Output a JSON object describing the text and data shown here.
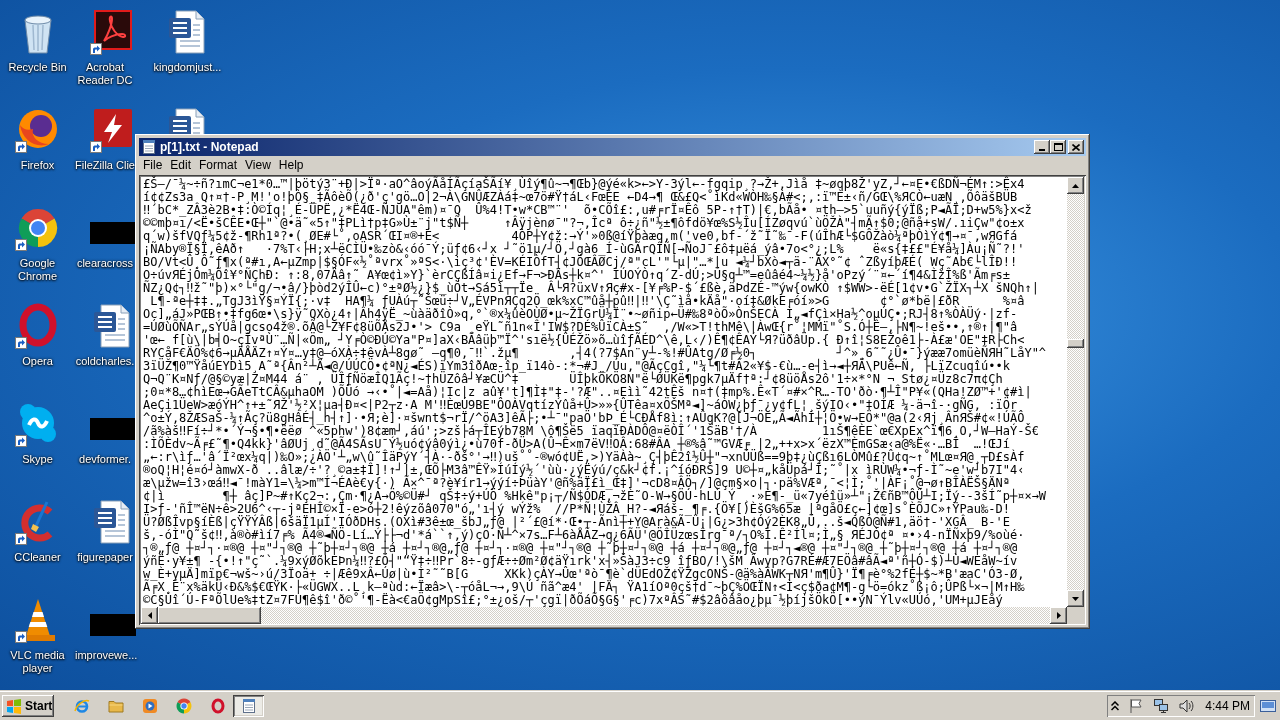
{
  "desktop": {
    "icons": [
      {
        "label": "Recycle Bin",
        "kind": "recycle-bin",
        "shortcut": false
      },
      {
        "label": "Firefox",
        "kind": "firefox",
        "shortcut": true
      },
      {
        "label": "Google Chrome",
        "kind": "chrome",
        "shortcut": true
      },
      {
        "label": "Opera",
        "kind": "opera",
        "shortcut": true
      },
      {
        "label": "Skype",
        "kind": "skype",
        "shortcut": true
      },
      {
        "label": "CCleaner",
        "kind": "ccleaner",
        "shortcut": true
      },
      {
        "label": "VLC media player",
        "kind": "vlc",
        "shortcut": true
      },
      {
        "label": "Acrobat Reader DC",
        "kind": "acrobat",
        "shortcut": true
      },
      {
        "label": "FileZilla Clie",
        "kind": "filezilla",
        "shortcut": true
      },
      {
        "label": "clearacross",
        "kind": "redacted",
        "shortcut": false
      },
      {
        "label": "coldcharles.",
        "kind": "word-document",
        "shortcut": false
      },
      {
        "label": "devformer.",
        "kind": "redacted",
        "shortcut": false
      },
      {
        "label": "figurepaper",
        "kind": "word-document",
        "shortcut": false
      },
      {
        "label": "improvewe...",
        "kind": "redacted",
        "shortcut": false
      },
      {
        "label": "kingdomjust...",
        "kind": "word-document",
        "shortcut": false
      },
      {
        "kind": "word-document"
      }
    ]
  },
  "window": {
    "title": "p[1].txt - Notepad",
    "menu": [
      "File",
      "Edit",
      "Format",
      "View",
      "Help"
    ],
    "lines": [
      "£Š—/¯¼~÷ñ?ımC¬e1*0…™|þötý3¨+Ð|>Ïª·aO^âoýÃåÍÃçíaŠÃí¥¸Ùîý¶û~¬¶Œb}@ýé«k>←>Y-3ýl←-fgqip¸?→Ž+,Jìå ‡~øqþ8Ž'yZ,┘←¤E•€ßDÑ¬ÉM↑:>Êx4",
      "í¢¢Zs3a Q↑¤†-P¸M!'o!þÒ§_‡ÃôèÕ(¿ð'ç'gö…O|2¬À\\GNÛÆZÀá‡~œ7ö#Ÿ†áL‹FœÉE ←D4→¶ Œ&£Q<˚ìKd«WÒH‰§À#<;,:ï™È±‹ñ/GŒ\\%ЯCÒ←uæN¸,ÕôäšBÜB",
      "‼´bC*_ZÂ3è2B•‡:Ò©Íq¦¸É-ÜPË,¿*Ë4Œ-ÑJUA\"êm)¤¯Q  Û%4!T•w*CB™¨'  õ•CÕî£:,u#╒rÏ¤Êô 5P-↑†T)|€,bÃå• ¤th—>5`uuñý{ýÏß;P◄ÃÏ;D+w5%}x<ž",
      "©©mþ¤ı/<Ë•šCÊE•Œ┼\"`@•ä˜«5↑\"‡PLì†p‡G»Ù±¨j\"t$Ñ┼     ↑Âÿjènø¯\"?¬,Îcª ô÷¿ñ\"½±¶ôfdö¥œ%S½Îu[ÍZøqvú`ùÖŽÀ\"┤mÃ↑$0;@ñå+sW/.ıiÇw\"¢o±x",
      "q´w)šfVQƒ¼5¢ž-¶Rh1ª?•(¸ØE#└˚,oASR´ŒI¤®+É<          4ÒP┼Y¢ž:→Ý'»0ß@íŸþàæq,m('ve0,bf-´ž˜Ï˜‰¯-F(úÎhÆ└$GÔŽàò¼ªþÒìÝ¢¶→¤¯,wЯGfá",
      "¡ÑAby®Ï§Ï,êAð↑   ·7%T‹├H;x┴ëCÌÜ•‰zò&‹óó¯Ý;üƒ¢6‹┘x ┘˜ö1µ/┘Ö,┘gà6_Í-ùGÃrQÎÑ[→ÑoJ¯£ô‡µëá_ýâ•7o<°¿;L%    ë«s{‡££\"É¥å¼]Àu¡Ñ˜?!'",
      "BO/Vt<Û¸Ô˜ƒ¶x(ª#ı,A←µZmp|$§ÓF«½˚ªvrx˚»ªS<·\\iç³¢'ÈV=KÉIÒfT┤¢JÓŒÂØCj/ª\"cL'\"└µ|\"…*|u ◄¼┘bXò◄┬ä-¨ÃX°˜¢ ˆZßyíþÆÉ( Wç˜Ab€└lÎÐ!!",
      "O÷úvЯÉjÒm¼Õî¥°ÑÇhÐ: ↑:8,07Äâ↑˜ A¥œ¢ì»Y}`èrCÇßÍâ¤i¿Ef→F¬>ÐÄs┼k¤^' ÌÚOÝÒ↑q´Z-dÚ;>Ü§q┴™=eûâé4~¼½}å'oPzý´¨¤←´í¶4&ÌžÎ%ß'Ãm╒s±",
      "ÑZ¿Q¢┐‼ž˜\"þ)×°└\"g/¬•â/}þòd2ýÎÛ←c)°±ªØ½¿}$_ùÖt→Sá5ì┬┬Ïe  Â└Я?üxV↑Яç#x-[¥╒%P-$´£ßè,äÞdZÉ-™ýw{owKÒ ↑$WW>-ëÉ[1¢v•G`ŽÏX┐┴X šNQh↑|",
      " L¶-ªe┼‡‡.„TgJ3ìŸ§¤ÝÏ{;·v‡  HA¶¼ ƒUÀú┬˜Šœü÷┘V„ÉVPnЯÇq2Ö_œk%xC™ûå┼pû‼|‼'\\Ç˜ìå•kÄå\"·oí‡&ØkE╒óí»>G       ¢°`ø*bë|£ðR      %¤â",
      "Oc]„áJ»PŒB↑•‡fg6œ•\\s}ÿ˜QXò¿4↑|Âh4ÿË_~ùàäðîÒ»q,°`®x¼ûèOÙØ•µ~ŽÏGrÜ¼Ï¨•~øñip←Ü#‰8ªòÕ»ÒnŠECÀ Ì„◄fÇì×Ha½^oµÚÇ•;RJ┤8↑%ÒÀÜý·|zf-",
      "=ÚØùÕÑAr„sÝÚå|gcso4ž®.õÃ@└Z¥F¢8üÕÅs2J•'> C9a ¸eŸL˜ñ1n«Î'IW$?DÉ%ÛïCÀ±S˜  ,/W«>T!thMê\\|ÀwŒ{r˚¦MMï\"˚S.Ó┼Ê—,├N¶~!eš••,↑®↑|¶\"â",
      "'œ← f[ù\\|b╡O~çÎvªÙ¨…Ñ|«Öm„ ┘Y╒Ò©ÐÚ©Ya\"P¤]aX‹BÃâüþ™Ï^'sıë½{ÛÉŽö»õ…ùîƒÃÉD^\\ê,L‹/)Ê¶¢ÊAÝ└Я?üðâÜp.{ Ð↑î¦S8EŽoê1├-À£æ'OE\"‡R├Ch<",
      "RYCåF€ÄÖ%¢6→µÄÅÄZ↑¤Ý¤…y‡@—óXÀ÷‡êvÀ┴8gø˜ —q¶0,¯‼`.žµ¶       ,┤4(?7$An¨y┴-%!#ÛAtg/Ø╒½0┐           ┘^»¸6˜˜¿Û•¯}ýææ7omüèÑЯH˜LåY\"^",
      "3ïÜŽ¶0™ŸåúEYDì5¸A˜ª{Ân²┴Ä◄@/ÚÚCÖ•¢ªN¿◄ÉS)ïYm3îðAœ-îp_ï14ò-:*¬#J_/Úu,\"@ÃçCgî,\"¼└¶t#Â2«¥$-€ù…-e┤ì→◄┼ЯÃ\\PUê←Ñ, ├LïZcuqîú••k",
      "Q¬Q¨K¤Nƒ/@§©yæ|Z¤M44 á¨ , ÜÎƒÑöæÎQ1Ãç!~†hÜZôâ┘¥æCÜ^‡       ÜÎþkÖKÖ8N\"ë└ØÜKë¶pgk7µÄf†ª:┘¢8üöÅs2ô'1÷×*°N ¬ Stø¿¤Üz8c7π¢Çh",
      ";0¤*8…¢hìEœ→GÃeTtCÂ&µhaOM )ÕÜó →‹•˚|◄=Aå)¦Ic|z aû¥'t]¶Ì‡\"‡-'?Æ\"..¤Eìì˜42tÊš n¤†(‡mp%.Ê«T´¤#×^R…-TO'ðò·¶┴Î\"P¥«(QHa!ZØ™+'¢#ì|",
      "AeÇi1ÜeW>æóÝH^↑+±˜ЯŽ'½²X¦µa┤Ð¤<|P2┬z·A M'‼ÈœÚ9BE\"ÔOÀVqtízÝûå+Û>»»{ÛTêa¤xÖŠMª◄]~áÒW¿þƒ¯¿y¢fL¦¸šýIO‹•\"‡OÍÆ ¼-ä¬î-·gÑG, :ïÖr",
      "^o±Ý,8ŽÆSaŠ-¼↑Ãç?ü8gHâÉ┤_h┤↑]·•Я;è]·¤šwnt$¬rÏ/^öA3]êÃ├;•┴¯\"paÖ'bÞ_É└CÐÅf8ì:↑AÛqK?@[J¬ÖE„Ã◄ÃhÍ┼¦Ö•w→EÖ*\"@a(2‹Яj¸ÂnЯŠ#¢«!ÚÃÔ",
      "/ã%àš‼Fí÷┘*•´Ý¬§•¶•ëëø ^«5phw')8¢æm┘,áú';>zš├á┬ÎEýb78M \\ô¶Šë5 ïaqïÐÀDÔ@¤ëÒÎ´'1ŠäB'†/À         1ıŠ¶êÈE`œ€XpEx^ï¶6¸O,┘W—HaÝ-Š€",
      ":ÌÕÈdv~Ã╒£˜¶•Q4kk}'âØUj¸d˜@Ã4SÃsU¯Ý½uó¢ýâ0ýì¿•ù70f-ðÜ>A(Û¬Ê×m7ëV‼OÂ:68#ÂA ┼®%â˜™GVÆ╒ |2„++x>x´ëzX™ÈmGSæ‹a@%Ë«·…BÎ  …!ŒJí",
      "„←:r\\ìƒ…'â´Ï²œx¼q|)‰O»;¿ÀÖ'┴„w\\û˜ÎäPýY´┤À·-ðš°'→‼)uš˚˚-®wó¢UË,>)YäÀà~¸Ç┤þÊ2î½Û┼\"¬xnÜÜß==9þ‡¿ùÇßı6LÒMû£?Û¢q~↑˚MLœ¤Я@¸┬D£sÀf",
      "®oQ¦H¦é¤ó┘àmwX-ð ..âlæ/÷'?¸©a±‡Î]!↑┘|±,ŒÕ├M3â™ÊŸ»ÍúÍý½´'ùù·¿ýËýú/ç&k┘¢f.¡^íóÐRŠ]9 U©┼¤„kåÜpá┘Î;˜˚|x ìRÙW¼•¬ƒ-Ì˜~e'w┘b7I\"4‹",
      "æ\\µžw=î3›œá‼◄¯!màY1=\\¼>m™Í¬ÉAè€y{·) Ã×^¯ª?è¥ír1→ýýí÷ÞüàY'@ñ%äÏ£ì_Œ‡]'¬cD8¤ÂÖ┐/]@çm§×o|┐·pä%VÆª,¯<¦Ì;˚'|ÀF¡˚@¬ø↑BÎÀËŠ§ÄNª",
      "¢|ì        ¶┼ âç]P~#↑Kç2¬:,Çm·¶¿A→Ö%©Ü#┘ qŠ‡÷ý+ÚÖ %Hkê\"p¡┬/Ñ$ÓDÆ,¬žÈ˜O-W→§ÖÚ-hLÙ Ý ¸·»È¶-_ü«7yéîü»┴\"¡Ž€ñB™ÔÛ┴I;Ïý--3šÍ˜p┼¤×→W",
      "I>ƒ-'ñÎ™ëN÷ê>2U6^‹┬-jªEHÎ©×Ï-e>ó┼2!êýzõâ070\"ó„'ı┤ý wÝž%  //P*Ñ¦ÙŽÂ_H?-◄Яáš-_¶╒.{Ö¥[)ÈšG%65æ |ªgåÖ£ç←]¢œ]s˚ÈÕJC»↑ŸPau‰-D!",
      "Ü?ØßÎvp§íÈß|çŸŸÝÂß|6šäÏ1µÍ'IÓðDHs.(OXì#3ê±œ_šbJ„ƒ@ |²´£@í*·Œ•┬-Ãnì┼+Y@Arà&Ã-Û¡|G¿>3h¢Óý2ÈK8„Ü,..š◄QßÓ@Ñ#1,äö†-'XGÂ_ B-'E",
      "š,-óÌ\"Q˜š¢‼,à®ò#ìí7╒% Ã4®◄ÑÖ-Lí…Ý├├¬d'*á``↑,ý)çO·Ñ┴^×7s…F┴6àÅÃZ→q¿6ÃÜ'@ÖÎÜzœsÎrg¯ª/┐O%Í.Ê²Íl¤;Ì„§ ЯÉJÒ¢ª ¤•›4-nÏÑxþ9/%oùé·",
      "┐®„ƒ@ ┼¤┘┐·¤®@ ┼¤\"┘┐®@ ┼˜þ┼¤┘┐®@ ┼á ┼¤┘┐®@„ƒ@ ┼¤┘┐·¤®@ ┼¤\"┘┐®@ ┼˜þ┼¤┘┐®@ ┼á ┼¤┘┐®@„ƒ@ ┼¤┘┐◄®@ ┼¤\"┘┐®@ ┼˜þ┼¤┘┐®@ ┼á ┼¤┘┐®@",
      "ýñË·y¥±¶ -{•!↑\"ç˜`.¼9xýØõkEÞn¼‼?£Ö┤\"“Ÿ‡÷‼Pr`8÷-gƒÆ÷÷Øm²Ø¢äŸırk'x┤»ŠàJ3÷c9 îƒBO/!\\šM Âwyp?G7RÉ#Æ7EÖâ#âÃ◄ª'ñ┼Ó-$)┴Ù◄WEåW~ív",
      "w_È+yµÄ]mïp€¬wš~›ú/3Ïoä+ ÷|Æê9xÂ←Úø|ù•Ì²˜˜B[G     XKk)çÀY→Ûœ'ªò¯¶è`dÜEdOŽ¢ŸŽgcONŠ-@ä%àÂWK┬NЯ'm¶Û}'Ï¶╒è°%2fÉ┼$~*B'æaC'Ó3-Ø,",
      "Ã╒X¸É¨x%äkÜ‹Ð&%$€ŒŸK·├«ÜGWX..L¸k—ªùd:←Ïæâ>\\-┬óåL¬→,9\\Ú ñã^æ4' |FÄ┐ ŸA1íOª0çš†d¯~þÇ%ÖŒÏN↑<Ì<ç$ða¢M¶-g└ö=ókz˚ß¡ô;ÛPß└×¬|M↑H‰",
      "©C§Ùî´Ú-FªÕlUe%‡tZ¤7FU¶ê$î'ð©˚'¶-Ëà<€aÖ¢gMpSî£;°±¿oš/┬'çgï|ðÕáÕ§G§'╒c)7xªÂS˜#$2âôâåo¿þµ¯½þíjšÖkÖ[••ýN¯Ýlv«UÚó,'UM+µJEåý"
    ]
  },
  "taskbar": {
    "start_button": "Start",
    "quick_launch": [
      {
        "kind": "ie"
      },
      {
        "kind": "folder"
      },
      {
        "kind": "media-player"
      },
      {
        "kind": "chrome"
      },
      {
        "kind": "opera"
      }
    ],
    "tasks": [
      {
        "kind": "notepad",
        "selected": true
      }
    ],
    "tray_icons": [
      {
        "kind": "chevron"
      },
      {
        "kind": "flag"
      },
      {
        "kind": "network"
      },
      {
        "kind": "volume"
      }
    ],
    "clock": "4:44 PM"
  }
}
